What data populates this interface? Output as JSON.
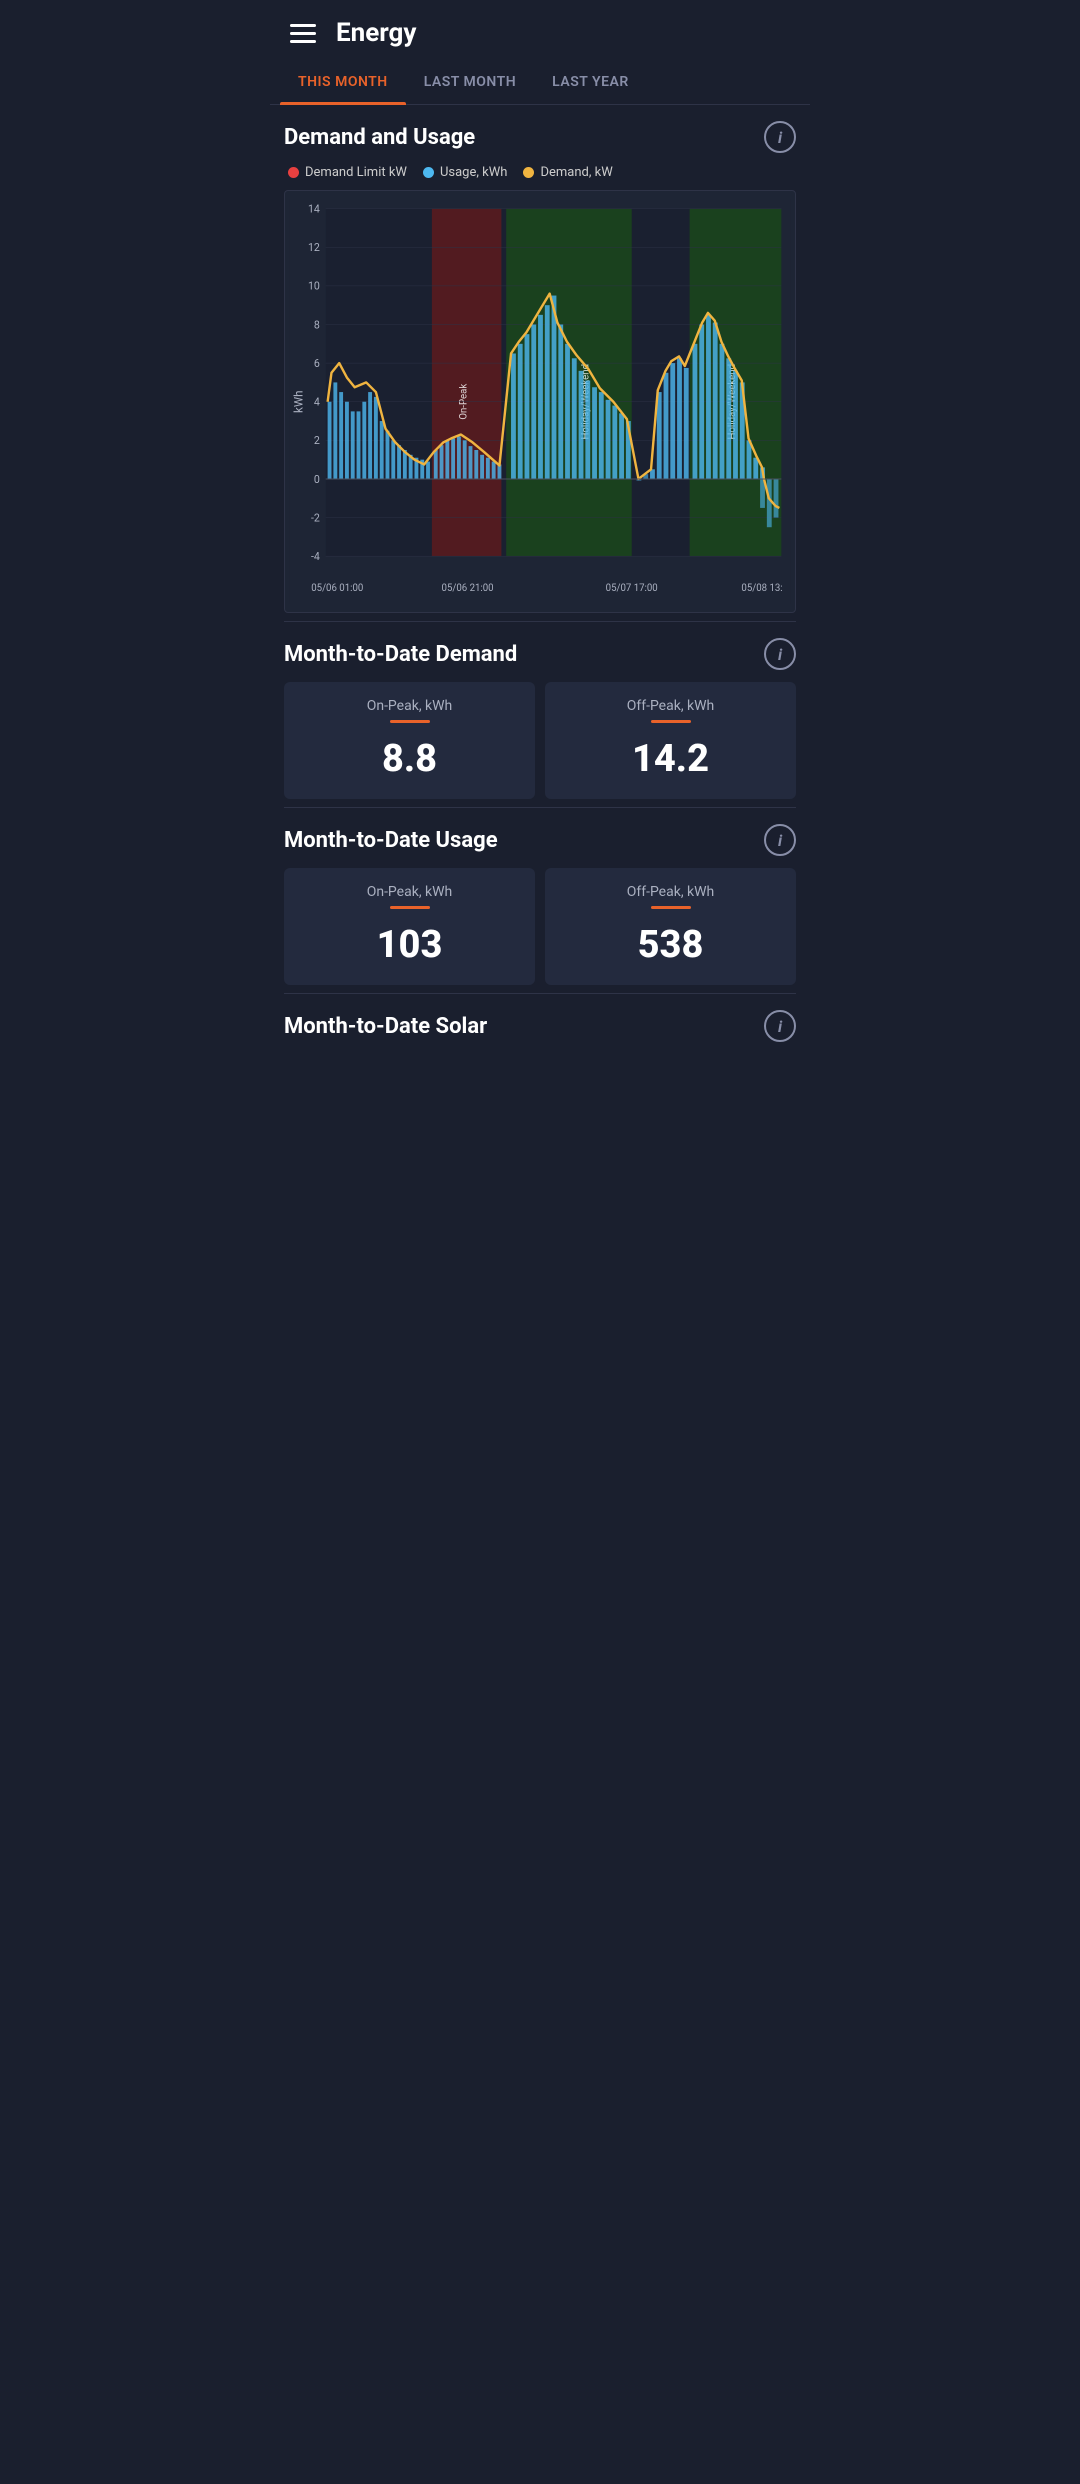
{
  "header": {
    "title": "Energy"
  },
  "tabs": [
    {
      "id": "this-month",
      "label": "THIS MONTH",
      "active": true
    },
    {
      "id": "last-month",
      "label": "LAST MONTH",
      "active": false
    },
    {
      "id": "last-year",
      "label": "LAST YEAR",
      "active": false
    }
  ],
  "demand_usage_section": {
    "title": "Demand and Usage",
    "info_label": "i",
    "legend": [
      {
        "label": "Demand Limit kW",
        "color": "#e84040"
      },
      {
        "label": "Usage, kWh",
        "color": "#4db8f0"
      },
      {
        "label": "Demand, kW",
        "color": "#f0b440"
      }
    ],
    "chart": {
      "y_axis_label": "kWh",
      "y_max": 14,
      "y_min": -4,
      "x_labels": [
        "05/06 01:00",
        "05/06 21:00",
        "05/07 17:00",
        "05/08 13:"
      ],
      "regions": [
        {
          "type": "normal",
          "label": ""
        },
        {
          "type": "on-peak",
          "label": "On-Peak"
        },
        {
          "type": "holiday",
          "label": "Holiday/Weekend"
        }
      ]
    }
  },
  "month_demand_section": {
    "title": "Month-to-Date Demand",
    "info_label": "i",
    "cards": [
      {
        "label": "On-Peak, kWh",
        "value": "8.8"
      },
      {
        "label": "Off-Peak, kWh",
        "value": "14.2"
      }
    ]
  },
  "month_usage_section": {
    "title": "Month-to-Date Usage",
    "info_label": "i",
    "cards": [
      {
        "label": "On-Peak, kWh",
        "value": "103"
      },
      {
        "label": "Off-Peak, kWh",
        "value": "538"
      }
    ]
  },
  "month_solar_section": {
    "title": "Month-to-Date Solar",
    "info_label": "i"
  }
}
